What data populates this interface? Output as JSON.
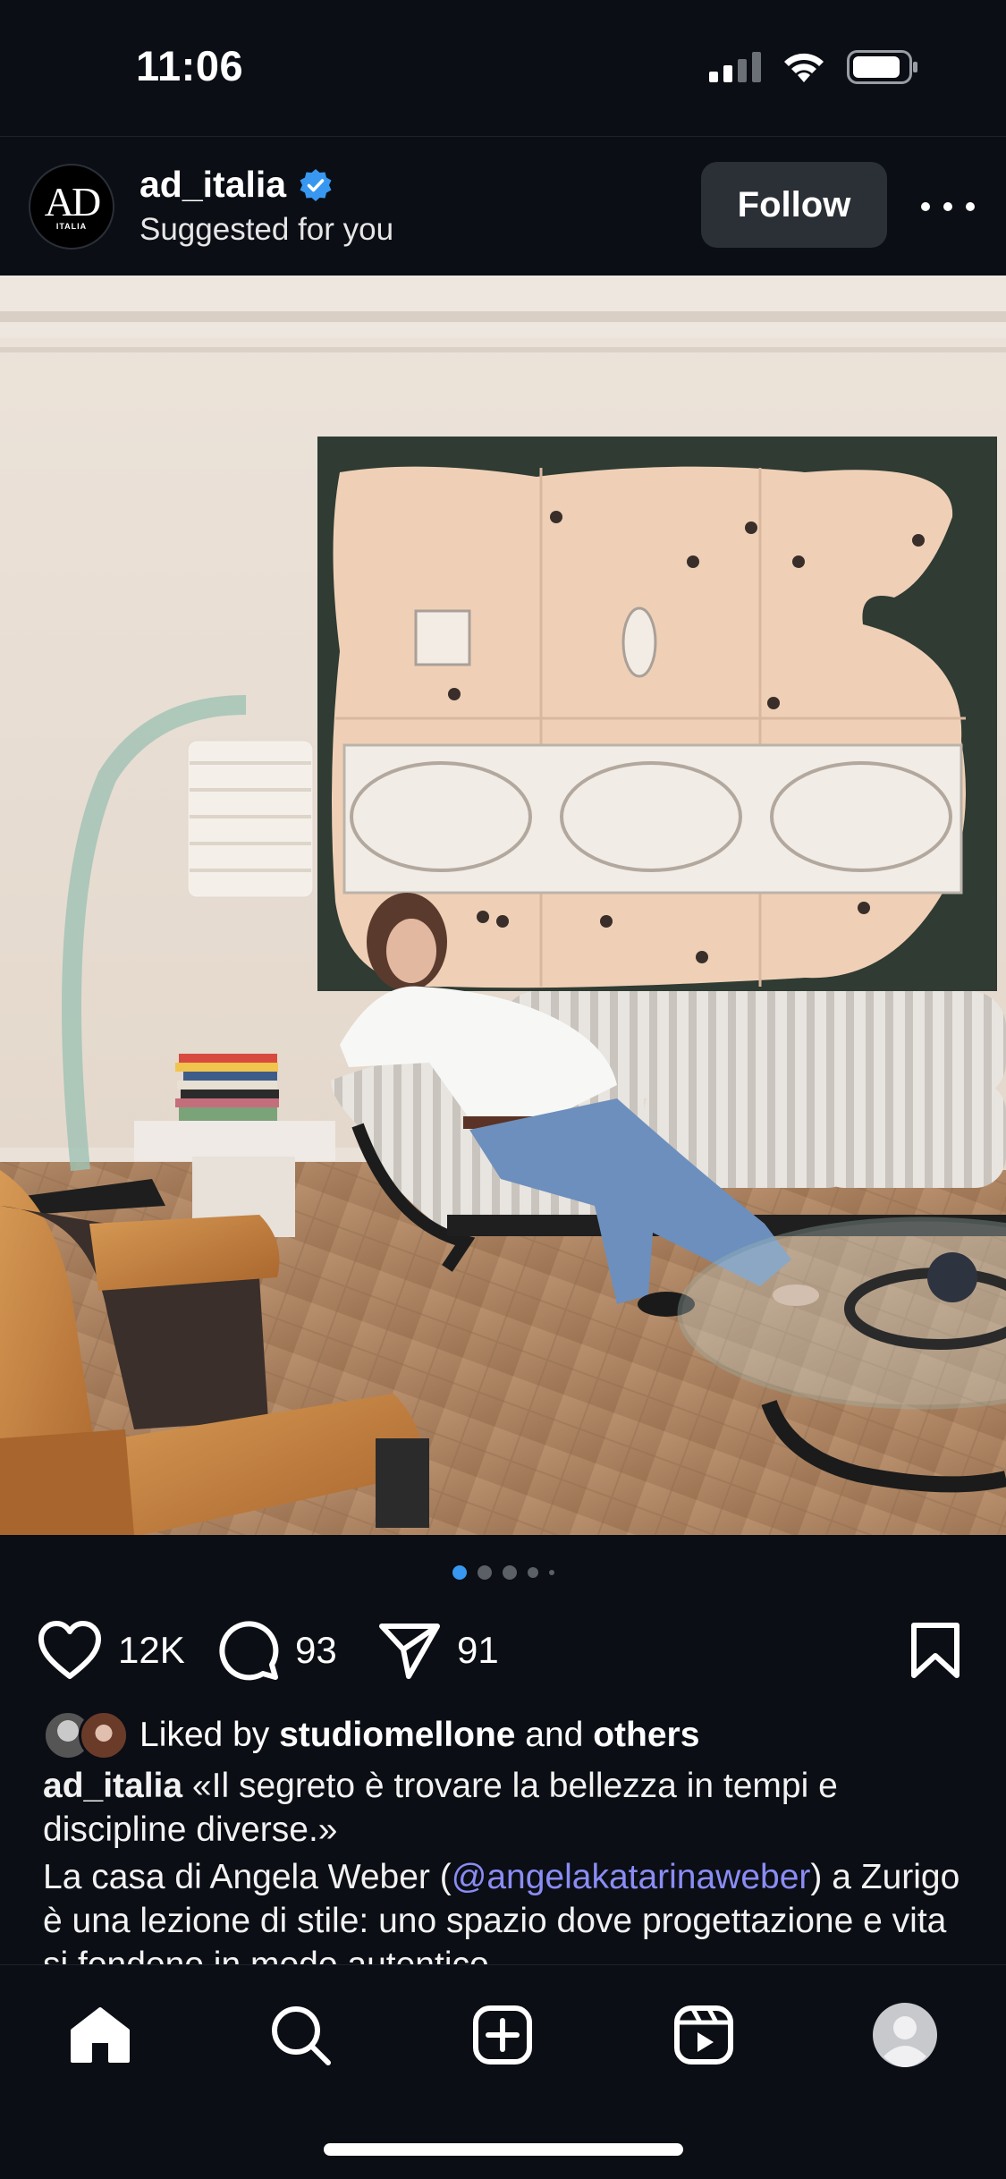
{
  "status_bar": {
    "time": "11:06"
  },
  "post": {
    "account": {
      "username": "ad_italia",
      "subtitle": "Suggested for you",
      "verified": true,
      "avatar_logo": "AD",
      "avatar_logo_sub": "ITALIA"
    },
    "follow_label": "Follow",
    "carousel": {
      "count": 5,
      "active_index": 0
    },
    "actions": {
      "likes": "12K",
      "comments": "93",
      "shares": "91"
    },
    "liked_by": {
      "prefix": "Liked by ",
      "user": "studiomellone",
      "middle": " and ",
      "others": "others"
    },
    "caption": {
      "username": "ad_italia",
      "quote": " «Il segreto è trovare la bellezza in tempi e discipline diverse.»",
      "body_start": "La casa di Angela Weber (",
      "mention": "@angelakatarinaweber",
      "body_end": ") a Zurigo è una lezione di stile: uno spazio dove progettazione e vita si fondono in modo autentico"
    }
  },
  "nav": {
    "items": [
      "home-icon",
      "search-icon",
      "create-icon",
      "reels-icon",
      "profile-icon"
    ]
  },
  "colors": {
    "background": "#0b0e14",
    "accent": "#3897f0",
    "mention": "#8a8cf5",
    "button": "#2b2f36"
  }
}
